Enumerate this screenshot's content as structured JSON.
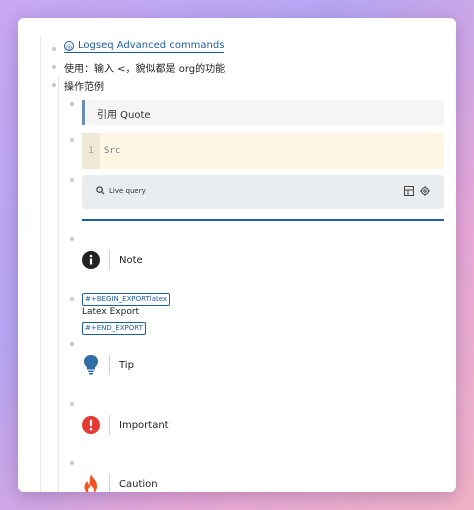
{
  "page": {
    "link_title": "Logseq Advanced commands",
    "line_usage": "使用：输入 <，貌似都是 org的功能",
    "line_examples": "操作范例"
  },
  "blocks": {
    "quote_text": "引用 Quote",
    "code_line_number": "1",
    "code_text": "Src",
    "query_label": "Live query",
    "note_label": "Note",
    "export_begin_tag": "#+BEGIN_EXPORTlatex",
    "export_text": "Latex Export",
    "export_end_tag": "#+END_EXPORT",
    "tip_label": "Tip",
    "important_label": "Important",
    "caution_label": "Caution"
  },
  "colors": {
    "accent": "#1f5fa0",
    "note": "#222222",
    "tip": "#2f6ea5",
    "important": "#e53935",
    "caution": "#f4511e"
  },
  "icons": [
    "link-icon",
    "search-icon",
    "table-icon",
    "settings-icon",
    "info-icon",
    "lightbulb-icon",
    "exclamation-icon",
    "fire-icon"
  ]
}
